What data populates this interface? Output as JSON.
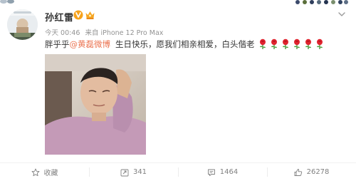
{
  "post": {
    "username": "孙红雷",
    "time": "今天 00:46",
    "source": "来自 iPhone 12 Pro Max",
    "text_before": "胖乎乎",
    "mention": "@黄磊微博",
    "text_after": "生日快乐，愿我们相亲相爱，白头偕老",
    "rose_count": 6
  },
  "footer": {
    "favorite_label": "收藏",
    "repost_count": "341",
    "comment_count": "1464",
    "like_count": "26278"
  },
  "colors": {
    "mention": "#eb7350",
    "meta": "#939393",
    "footer_text": "#808080",
    "vip_orange": "#f7a21b"
  },
  "icons": {
    "vbadge": "verified-v-icon",
    "crown": "vip-crown-icon",
    "chevron": "chevron-down-icon",
    "favorite": "star-icon",
    "repost": "repost-icon",
    "comment": "comment-icon",
    "like": "thumbs-up-icon",
    "rose": "rose-emoji-icon"
  }
}
